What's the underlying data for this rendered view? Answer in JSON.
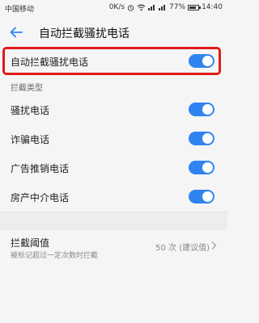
{
  "status": {
    "carrier": "中国移动",
    "speed": "0K/s",
    "battery_text": "77%",
    "battery_level": 0.77,
    "time": "14:40"
  },
  "header": {
    "title": "自动拦截骚扰电话"
  },
  "main_toggle": {
    "label": "自动拦截骚扰电话",
    "on": true
  },
  "section": {
    "title": "拦截类型"
  },
  "types": [
    {
      "label": "骚扰电话",
      "on": true
    },
    {
      "label": "诈骗电话",
      "on": true
    },
    {
      "label": "广告推销电话",
      "on": true
    },
    {
      "label": "房产中介电话",
      "on": true
    }
  ],
  "threshold": {
    "title": "拦截阈值",
    "subtitle": "被标记超过一定次数时拦截",
    "value": "50 次 (建议值)"
  },
  "colors": {
    "accent": "#2f84f0",
    "highlight": "#e01a1a"
  }
}
